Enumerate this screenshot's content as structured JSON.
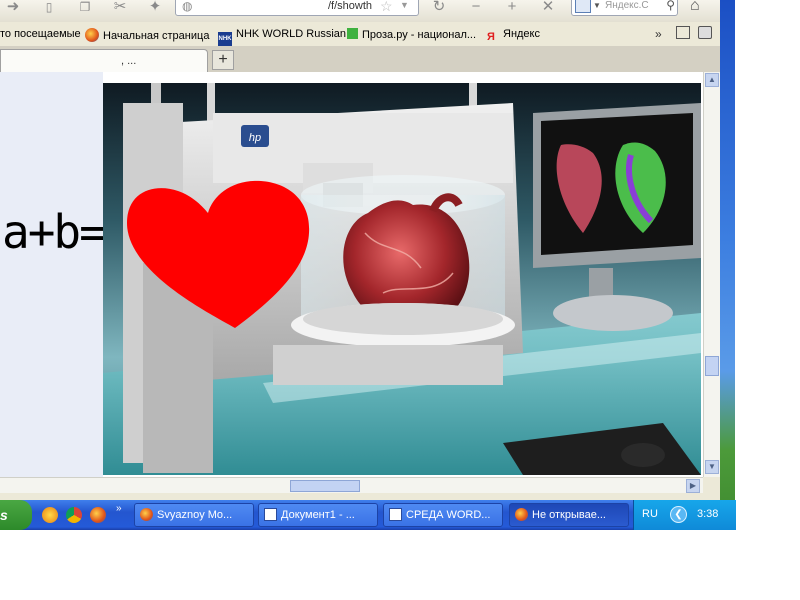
{
  "browser": {
    "nav": {
      "url_text": "/f/showth",
      "search_placeholder": "Яндекс.С"
    },
    "bookmarks": [
      {
        "label": "то посещаемые",
        "icon": "none"
      },
      {
        "label": "Начальная страница",
        "icon": "firefox-icon"
      },
      {
        "label": "NHK WORLD Russian",
        "icon": "nhk-icon"
      },
      {
        "label": "Проза.ру - национал...",
        "icon": "green-square-icon"
      },
      {
        "label": "Яндекс",
        "icon": "yandex-icon"
      }
    ],
    "nhk_icon_text": "NHK",
    "yandex_icon_text": "Я",
    "tab": {
      "title": ", ...",
      "new_tab_label": "+"
    }
  },
  "content": {
    "formula": "a+b=",
    "image_description": "3D printer printing a human heart with a red heart shape overlay",
    "heart_color": "#ff0000"
  },
  "taskbar": {
    "start_label": "s",
    "buttons": [
      {
        "label": "Svyaznoy Mo...",
        "icon": "firefox-icon",
        "active": false
      },
      {
        "label": "Документ1 - ...",
        "icon": "word-icon",
        "active": false
      },
      {
        "label": "СРЕДА WORD...",
        "icon": "word-icon",
        "active": false
      },
      {
        "label": "Не открывае...",
        "icon": "firefox-icon",
        "active": true
      }
    ],
    "more_label": "»",
    "language": "RU",
    "clock": "3:38"
  },
  "colors": {
    "taskbar": "#245ad8",
    "tray": "#0f8ad8",
    "start": "#2d8a2a"
  }
}
